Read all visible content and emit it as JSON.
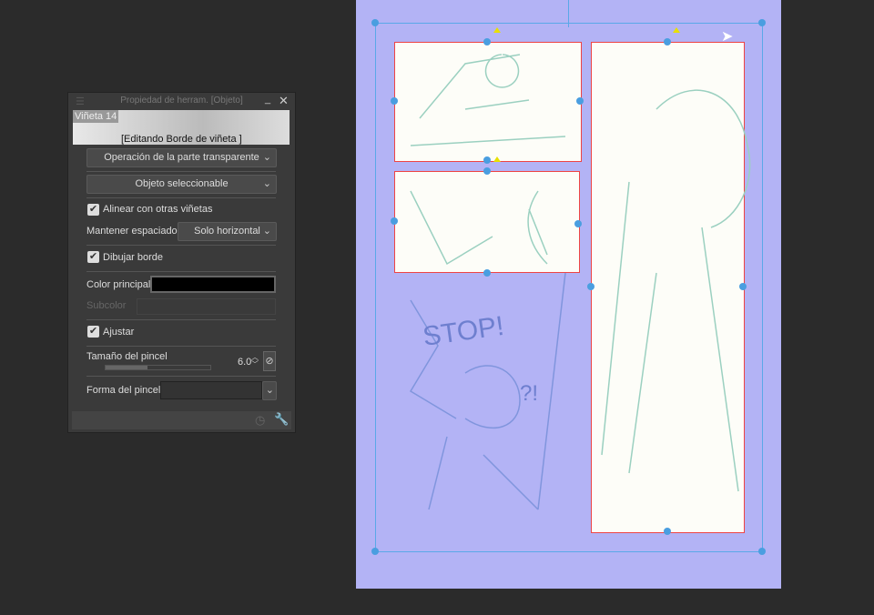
{
  "panel": {
    "title": "Propiedad de herram. [Objeto]",
    "preview_name": "Viñeta 14",
    "preview_caption": "[Editando Borde de viñeta ]",
    "transparent_op": "Operación de la parte transparente",
    "selectable": "Objeto seleccionable",
    "align_label": "Alinear con otras viñetas",
    "keep_spacing_label": "Mantener espaciado",
    "keep_spacing_value": "Solo horizontal",
    "draw_border_label": "Dibujar borde",
    "main_color_label": "Color principal",
    "main_color": "#000000",
    "subcolor_label": "Subcolor",
    "adjust_label": "Ajustar",
    "brush_size_label": "Tamaño del pincel",
    "brush_size_value": "6.0",
    "brush_shape_label": "Forma del pincel"
  },
  "canvas": {
    "sketch_text_1": "STOP!",
    "sketch_text_2": "?!"
  }
}
